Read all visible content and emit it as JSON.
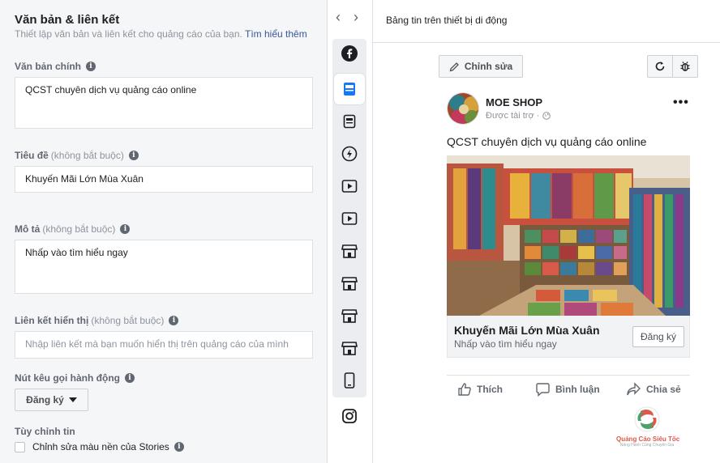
{
  "form": {
    "title": "Văn bản & liên kết",
    "subtitle": "Thiết lập văn bản và liên kết cho quảng cáo của bạn.",
    "learn_more": "Tìm hiểu thêm",
    "primary_text": {
      "label": "Văn bản chính",
      "value": "QCST chuyên dịch vụ quảng cáo online"
    },
    "headline": {
      "label": "Tiêu đề",
      "optional": "(không bắt buộc)",
      "value": "Khuyến Mãi Lớn Mùa Xuân"
    },
    "description": {
      "label": "Mô tả",
      "optional": "(không bắt buộc)",
      "value": "Nhấp vào tìm hiểu ngay"
    },
    "display_link": {
      "label": "Liên kết hiển thị",
      "optional": "(không bắt buộc)",
      "placeholder": "Nhập liên kết mà bạn muốn hiển thị trên quảng cáo của mình"
    },
    "cta": {
      "label": "Nút kêu gọi hành động",
      "value": "Đăng ký"
    },
    "customize": {
      "label": "Tùy chỉnh tin",
      "checkbox_label": "Chỉnh sửa màu nền của Stories"
    }
  },
  "rail": {
    "icons": [
      "facebook-icon",
      "mobile-feed-icon",
      "desktop-feed-icon",
      "instant-article-icon",
      "video-icon",
      "video-icon",
      "marketplace-icon",
      "marketplace-icon",
      "marketplace-icon",
      "marketplace-icon",
      "stories-icon",
      "instagram-icon"
    ],
    "selected_index": 1
  },
  "preview": {
    "placement_title": "Bảng tin trên thiết bị di động",
    "edit_label": "Chỉnh sửa",
    "page_name": "MOE SHOP",
    "sponsored": "Được tài trợ ·",
    "primary_text": "QCST chuyên dịch vụ quảng cáo online",
    "headline": "Khuyến Mãi Lớn Mùa Xuân",
    "description": "Nhấp vào tìm hiểu ngay",
    "cta": "Đăng ký",
    "actions": {
      "like": "Thích",
      "comment": "Bình luận",
      "share": "Chia sẻ"
    }
  },
  "watermark": {
    "text": "Quảng Cáo Siêu Tốc",
    "sub": "Nâng Hành Cùng Chuyên Gia"
  },
  "colors": {
    "accent": "#385898",
    "fb_blue": "#1877f2",
    "panel_bg": "#f5f6f7",
    "border": "#dddfe2"
  }
}
